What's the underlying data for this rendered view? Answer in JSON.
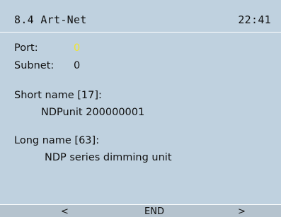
{
  "header": {
    "title": "8.4  Art-Net",
    "time": "22:41"
  },
  "fields": {
    "port_label": "Port:",
    "port_value": "0",
    "subnet_label": "Subnet:",
    "subnet_value": "0",
    "short_name_label": "Short name [17]:",
    "short_name_value": "NDPunit 200000001",
    "long_name_label": "Long name [63]:",
    "long_name_value": "NDP series dimming unit"
  },
  "footer": {
    "prev": "<",
    "end": "END",
    "next": ">"
  },
  "colors": {
    "background": "#bfd1df",
    "footer": "#b5c3ce",
    "highlight": "#f2e52a",
    "text": "#111111"
  }
}
